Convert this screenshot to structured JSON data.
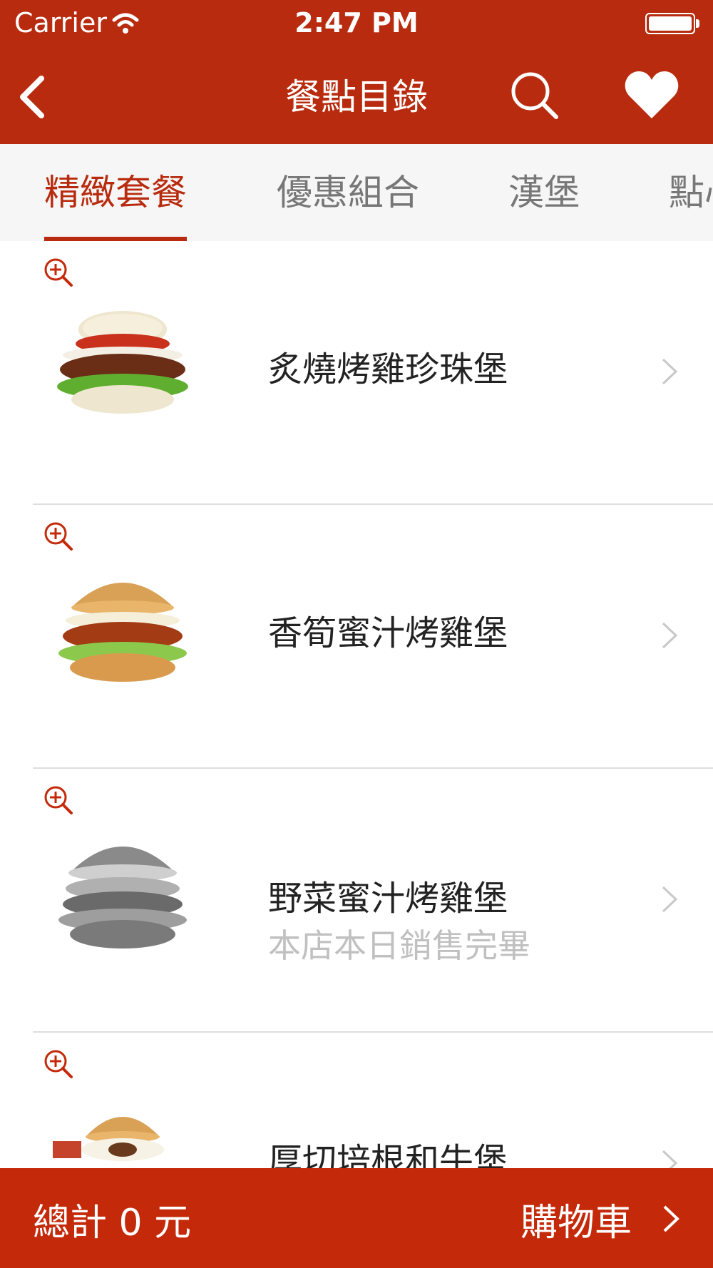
{
  "status_bar": {
    "carrier": "Carrier",
    "time": "2:47 PM"
  },
  "nav": {
    "title": "餐點目錄",
    "back_icon": "chevron-left-icon",
    "search_icon": "search-icon",
    "favorite_icon": "heart-icon"
  },
  "tabs": [
    {
      "label": "精緻套餐",
      "active": true
    },
    {
      "label": "優惠組合",
      "active": false
    },
    {
      "label": "漢堡",
      "active": false
    },
    {
      "label": "點心",
      "active": false
    }
  ],
  "menu_items": [
    {
      "name": "炙燒烤雞珍珠堡",
      "note": "",
      "sold_out": false
    },
    {
      "name": "香筍蜜汁烤雞堡",
      "note": "",
      "sold_out": false
    },
    {
      "name": "野菜蜜汁烤雞堡",
      "note": "本店本日銷售完畢",
      "sold_out": true
    },
    {
      "name": "厚切培根和牛堡",
      "note": "",
      "sold_out": false
    }
  ],
  "footer": {
    "total_label": "總計 0 元",
    "cart_label": "購物車"
  },
  "colors": {
    "brand_red": "#b82b0e",
    "tab_bg": "#f6f6f6",
    "muted_text": "#c0c0c0"
  }
}
